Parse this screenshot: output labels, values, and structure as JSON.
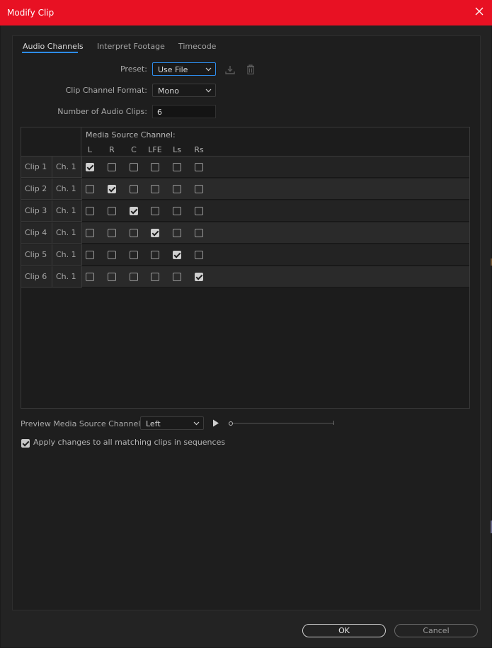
{
  "window": {
    "title": "Modify Clip",
    "accent": "#e81123"
  },
  "tabs": [
    {
      "label": "Audio Channels",
      "active": true
    },
    {
      "label": "Interpret Footage",
      "active": false
    },
    {
      "label": "Timecode",
      "active": false
    }
  ],
  "preset": {
    "label": "Preset:",
    "value": "Use File"
  },
  "clip_channel_format": {
    "label": "Clip Channel Format:",
    "value": "Mono"
  },
  "num_audio_clips": {
    "label": "Number of Audio Clips:",
    "value": "6"
  },
  "grid": {
    "header": "Media Source Channel:",
    "columns": [
      "L",
      "R",
      "C",
      "LFE",
      "Ls",
      "Rs"
    ],
    "rows": [
      {
        "clip": "Clip 1",
        "channel": "Ch. 1",
        "checked_index": 0
      },
      {
        "clip": "Clip 2",
        "channel": "Ch. 1",
        "checked_index": 1
      },
      {
        "clip": "Clip 3",
        "channel": "Ch. 1",
        "checked_index": 2
      },
      {
        "clip": "Clip 4",
        "channel": "Ch. 1",
        "checked_index": 3
      },
      {
        "clip": "Clip 5",
        "channel": "Ch. 1",
        "checked_index": 4
      },
      {
        "clip": "Clip 6",
        "channel": "Ch. 1",
        "checked_index": 5
      }
    ]
  },
  "preview": {
    "label": "Preview Media Source Channel:",
    "value": "Left"
  },
  "apply_changes": {
    "label": "Apply changes to all matching clips in sequences",
    "checked": true
  },
  "buttons": {
    "ok": "OK",
    "cancel": "Cancel"
  }
}
